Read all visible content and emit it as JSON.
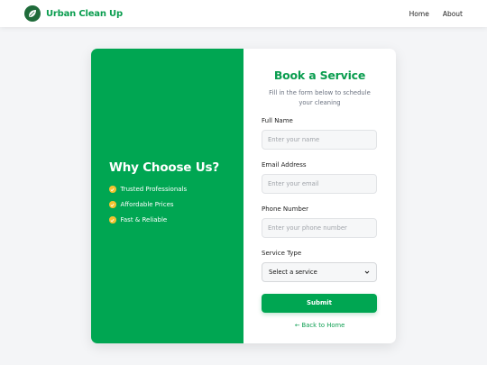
{
  "navbar": {
    "brand": "Urban Clean Up",
    "links": [
      "Home",
      "About"
    ]
  },
  "why": {
    "title": "Why Choose Us?",
    "items": [
      "Trusted Professionals",
      "Affordable Prices",
      "Fast & Reliable"
    ]
  },
  "form": {
    "title": "Book a Service",
    "subtitle": "Fill in the form below to schedule your cleaning",
    "full_name_label": "Full Name",
    "full_name_placeholder": "Enter your name",
    "email_label": "Email Address",
    "email_placeholder": "Enter your email",
    "phone_label": "Phone Number",
    "phone_placeholder": "Enter your phone number",
    "service_label": "Service Type",
    "service_selected": "Select a service",
    "submit_label": "Submit",
    "back_label": "← Back to Home"
  },
  "colors": {
    "brand_green": "#00a652",
    "check_yellow": "#f2c230",
    "page_bg": "#f4f5f7"
  },
  "icons": {
    "logo": "leaf-logo-icon",
    "check": "check-circle-icon",
    "select_arrow": "chevron-down-icon"
  }
}
